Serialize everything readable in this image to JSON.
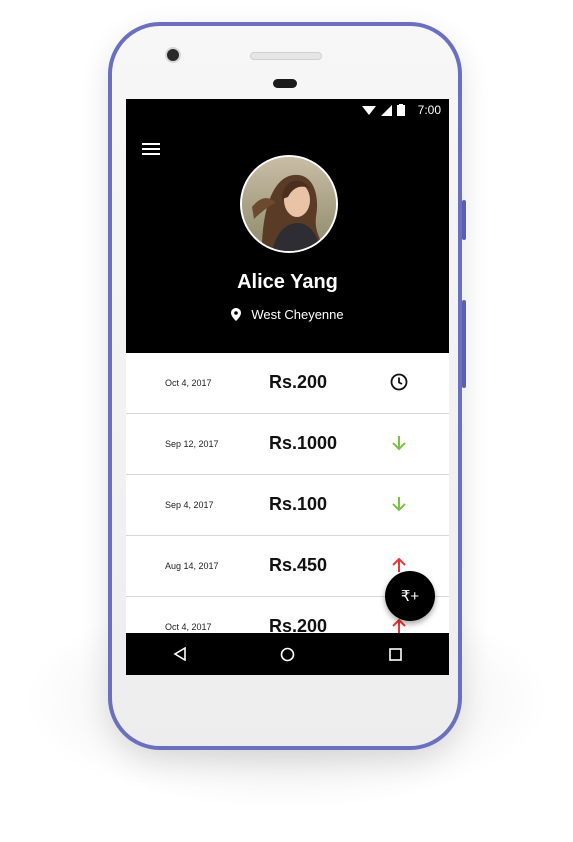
{
  "status_bar": {
    "time": "7:00"
  },
  "profile": {
    "name": "Alice Yang",
    "location": "West Cheyenne"
  },
  "transactions": [
    {
      "date": "Oct 4, 2017",
      "amount": "Rs.200",
      "status_icon": "clock-icon"
    },
    {
      "date": "Sep 12, 2017",
      "amount": "Rs.1000",
      "status_icon": "arrow-down-icon"
    },
    {
      "date": "Sep 4, 2017",
      "amount": "Rs.100",
      "status_icon": "arrow-down-icon"
    },
    {
      "date": "Aug 14, 2017",
      "amount": "Rs.450",
      "status_icon": "arrow-up-icon"
    },
    {
      "date": "Oct 4, 2017",
      "amount": "Rs.200",
      "status_icon": "arrow-up-icon"
    }
  ],
  "fab": {
    "label": "₹+"
  },
  "colors": {
    "header_bg": "#000000",
    "incoming": "#7cc242",
    "outgoing": "#e53935",
    "phone_frame": "#6a6fc0"
  }
}
